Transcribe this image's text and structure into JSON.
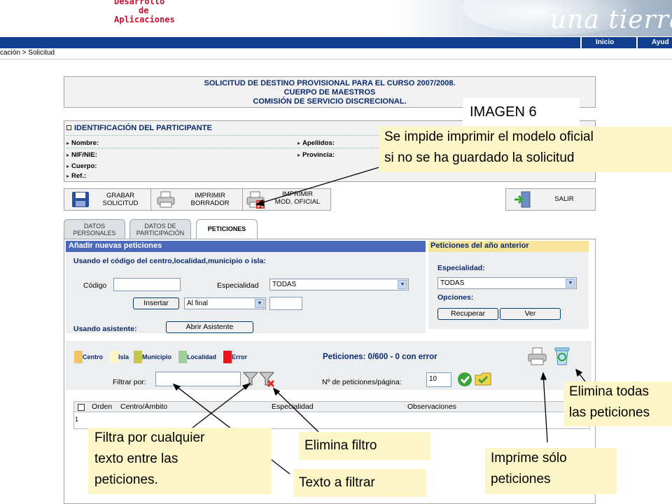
{
  "header": {
    "logo_line1": "Desarrollo",
    "logo_line2": "de",
    "logo_line3": "Aplicaciones",
    "slogan": "una tierra",
    "nav": [
      "Inicio",
      "Ayud"
    ],
    "breadcrumb": "cación > Solicitud"
  },
  "title": {
    "line1": "SOLICITUD DE DESTINO PROVISIONAL PARA EL CURSO 2007/2008.",
    "line2": "CUERPO DE MAESTROS",
    "line3": "COMISIÓN DE SERVICIO DISCRECIONAL."
  },
  "identification": {
    "title": "IDENTIFICACIÓN DEL PARTICIPANTE",
    "fields": {
      "nombre": "Nombre:",
      "apellidos": "Apellidos:",
      "nif": "NIF/NIE:",
      "provincia": "Provincia:",
      "cuerpo": "Cuerpo:",
      "ref": "Ref.:"
    }
  },
  "toolbar": {
    "save": [
      "GRABAR",
      "SOLICITUD"
    ],
    "print_draft": [
      "IMPRIMIR",
      "BORRADOR"
    ],
    "print_official": [
      "IMPRIMIR",
      "MOD. OFICIAL"
    ],
    "exit": "SALIR"
  },
  "tabs": [
    [
      "DATOS",
      "PERSONALES"
    ],
    [
      "DATOS DE",
      "PARTICIPACIÓN"
    ],
    [
      "PETICIONES"
    ]
  ],
  "add_requests": {
    "title": "Añadir nuevas peticiones",
    "subtitle": "Usando el código del centro,localidad,municipio o isla:",
    "code_label": "Código",
    "code_value": "",
    "specialty_label": "Especialidad",
    "specialty_value": "TODAS",
    "insert_button": "Insertar",
    "position_value": "Al final",
    "position_extra": "",
    "wizard_label": "Usando asistente:",
    "wizard_button": "Abrir Asistente"
  },
  "previous_year": {
    "title": "Peticiones del año anterior",
    "specialty_label": "Especialidad:",
    "specialty_value": "TODAS",
    "options_label": "Opciones:",
    "recover_button": "Recuperar",
    "view_button": "Ver"
  },
  "legend": {
    "items": [
      {
        "label": "Centro",
        "color": "#f2c46a"
      },
      {
        "label": "Isla",
        "color": "#fdf7c6"
      },
      {
        "label": "Municipio",
        "color": "#c5c84c"
      },
      {
        "label": "Localidad",
        "color": "#9fd09a"
      },
      {
        "label": "Error",
        "color": "#e8161c"
      }
    ]
  },
  "requests_status": "Peticiones: 0/600 - 0 con error",
  "filter": {
    "label": "Filtrar por:",
    "value": ""
  },
  "paging": {
    "label": "Nº de peticiones/página:",
    "value": "10"
  },
  "table": {
    "columns": [
      "Orden",
      "Centro/Ámbito",
      "Especialidad",
      "Observaciones"
    ],
    "rows": [
      [
        "1",
        "",
        "",
        ""
      ]
    ]
  },
  "annotations": {
    "image_label": "IMAGEN 6",
    "print_note_line1": "Se impide imprimir el modelo oficial",
    "print_note_line2": "si no se ha guardado la solicitud",
    "delete_all_line1": "Elimina todas",
    "delete_all_line2": "las peticiones",
    "filter_note_line1": "Filtra por cualquier",
    "filter_note_line2": "texto entre las",
    "filter_note_line3": "peticiones.",
    "remove_filter": "Elimina filtro",
    "filter_text": "Texto a filtrar",
    "print_only_line1": "Imprime sólo",
    "print_only_line2": "peticiones"
  },
  "colors": {
    "nav_blue": "#12408f",
    "section_blue": "#4b69b8",
    "title_navy": "#0b2a6b",
    "callout_yellow": "#fdf6c8",
    "prev_year_yellow": "#f6e59a",
    "logo_red": "#c8102e"
  }
}
